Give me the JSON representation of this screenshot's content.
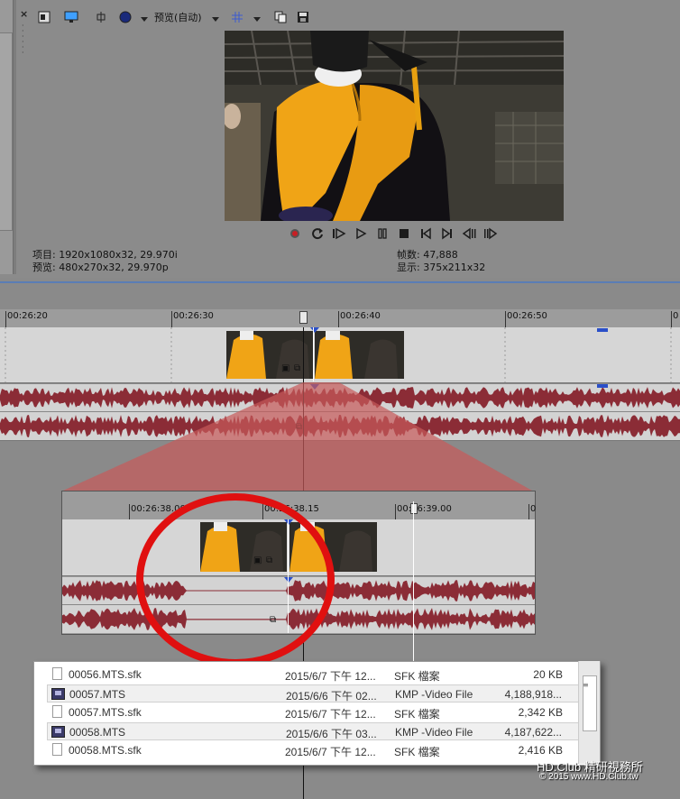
{
  "toolbar": {
    "close_icon": "×",
    "preview_quality": "预览(自动)",
    "icons": [
      "properties-icon",
      "monitor-icon",
      "split-screen-icon",
      "overlay-icon",
      "grid-icon",
      "copy-snapshot-icon",
      "save-snapshot-icon"
    ]
  },
  "info": {
    "project": "项目: 1920x1080x32, 29.970i",
    "preview": "预览: 480x270x32, 29.970p",
    "frames": "帧数: 47,888",
    "display": "显示: 375x211x32"
  },
  "transport": {
    "icons": [
      "record-icon",
      "loop-icon",
      "play-from-start-icon",
      "play-icon",
      "pause-icon",
      "stop-icon",
      "go-to-start-icon",
      "go-to-end-icon",
      "prev-frame-icon",
      "next-frame-icon"
    ]
  },
  "timeline": {
    "ruler": [
      "00:26:20",
      "00:26:30",
      "00:26:40",
      "00:26:50",
      "0"
    ]
  },
  "inset": {
    "ruler": [
      "00:26:38.00",
      "00:26:38.15",
      "00:26:39.00",
      "0"
    ]
  },
  "colors": {
    "waveform": "#8b2c36",
    "highlight_ring": "#e01010",
    "zoom_cone": "#c85a5a",
    "marker": "#2a4fc8"
  },
  "explorer": {
    "rows": [
      {
        "name": "00056.MTS.sfk",
        "date": "2015/6/7 下午 12...",
        "type": "SFK 檔案",
        "size": "20 KB",
        "icon": "sfk-file-icon",
        "selected": false
      },
      {
        "name": "00057.MTS",
        "date": "2015/6/6 下午 02...",
        "type": "KMP -Video File",
        "size": "4,188,918...",
        "icon": "mts-video-file-icon",
        "selected": true
      },
      {
        "name": "00057.MTS.sfk",
        "date": "2015/6/7 下午 12...",
        "type": "SFK 檔案",
        "size": "2,342 KB",
        "icon": "sfk-file-icon",
        "selected": false
      },
      {
        "name": "00058.MTS",
        "date": "2015/6/6 下午 03...",
        "type": "KMP -Video File",
        "size": "4,187,622...",
        "icon": "mts-video-file-icon",
        "selected": true
      },
      {
        "name": "00058.MTS.sfk",
        "date": "2015/6/7 下午 12...",
        "type": "SFK 檔案",
        "size": "2,416 KB",
        "icon": "sfk-file-icon",
        "selected": false
      }
    ]
  },
  "watermark": {
    "line1": "HD.Club 精研視務所",
    "line2": "© 2015  www.HD.Club.tw"
  }
}
